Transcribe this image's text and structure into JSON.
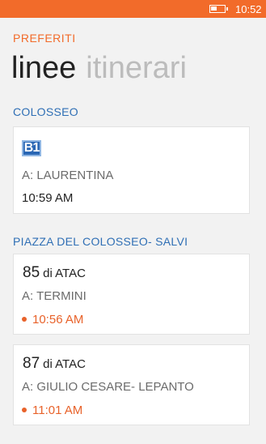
{
  "statusbar": {
    "time": "10:52",
    "battery_icon": "battery-icon",
    "color": "#f26b2a"
  },
  "app_title": "PREFERITI",
  "pivot": {
    "items": [
      "linee",
      "itinerari"
    ],
    "active_index": 0
  },
  "colors": {
    "accent": "#f26b2a",
    "section": "#2f6fb5",
    "live_time": "#e8622a"
  },
  "sections": [
    {
      "title": "COLOSSEO",
      "cards": [
        {
          "badge": "B1",
          "destination": "A: LAURENTINA",
          "time": "10:59 AM",
          "live": false
        }
      ]
    },
    {
      "title": "PIAZZA DEL COLOSSEO- SALVI",
      "cards": [
        {
          "line": "85",
          "operator": "di ATAC",
          "destination": "A: TERMINI",
          "time": "10:56 AM",
          "live": true
        },
        {
          "line": "87",
          "operator": "di ATAC",
          "destination": "A: GIULIO CESARE- LEPANTO",
          "time": "11:01 AM",
          "live": true
        }
      ]
    }
  ]
}
